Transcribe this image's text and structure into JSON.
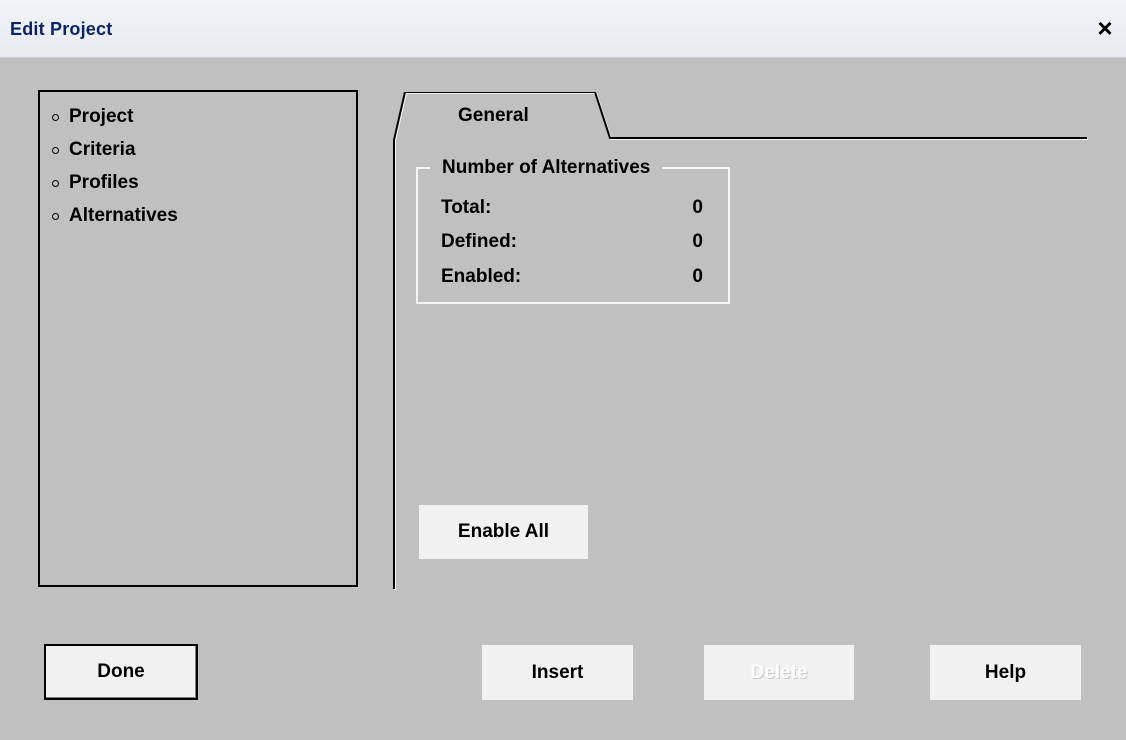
{
  "window": {
    "title": "Edit Project",
    "close_label": "×"
  },
  "tree": {
    "items": [
      {
        "label": "Project"
      },
      {
        "label": "Criteria"
      },
      {
        "label": "Profiles"
      },
      {
        "label": "Alternatives"
      }
    ]
  },
  "tabs": [
    {
      "label": "General",
      "selected": true
    }
  ],
  "group": {
    "legend": "Number of Alternatives",
    "rows": [
      {
        "label": "Total:",
        "value": "0"
      },
      {
        "label": "Defined:",
        "value": "0"
      },
      {
        "label": "Enabled:",
        "value": "0"
      }
    ]
  },
  "buttons": {
    "enable_all": "Enable All",
    "done": "Done",
    "insert": "Insert",
    "delete": "Delete",
    "help": "Help"
  },
  "colors": {
    "background": "#c0c0c0",
    "title_text": "#0a246a",
    "button_face": "#f1f1f1"
  }
}
